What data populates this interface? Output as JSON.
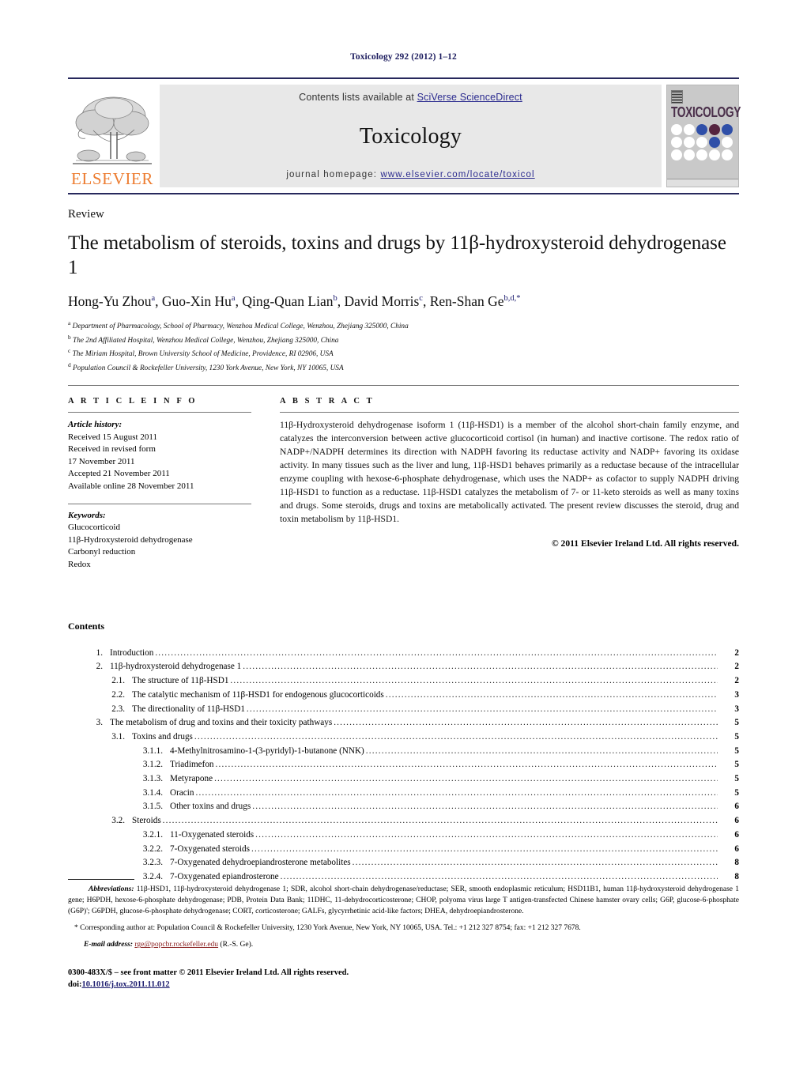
{
  "running_head": "Toxicology 292 (2012) 1–12",
  "masthead": {
    "publisher_name": "ELSEVIER",
    "contents_prefix": "Contents lists available at ",
    "contents_link": "SciVerse ScienceDirect",
    "journal_name": "Toxicology",
    "homepage_prefix": "journal homepage: ",
    "homepage_link": "www.elsevier.com/locate/toxicol",
    "cover_title": "TOXICOLOGY",
    "link_color": "#2b2b8f",
    "rule_color": "#27285c",
    "banner_bg": "#e8e8e8"
  },
  "article": {
    "doctype": "Review",
    "title": "The metabolism of steroids, toxins and drugs by 11β-hydroxysteroid dehydrogenase 1",
    "authors_html": "Hong-Yu Zhou a , Guo-Xin Hu a , Qing-Quan Lian b , David Morris c , Ren-Shan Ge b,d,*",
    "authors": [
      {
        "name": "Hong-Yu Zhou",
        "marks": "a"
      },
      {
        "name": "Guo-Xin Hu",
        "marks": "a"
      },
      {
        "name": "Qing-Quan Lian",
        "marks": "b"
      },
      {
        "name": "David Morris",
        "marks": "c"
      },
      {
        "name": "Ren-Shan Ge",
        "marks": "b,d,*"
      }
    ],
    "affiliations": [
      {
        "mark": "a",
        "text": "Department of Pharmacology, School of Pharmacy, Wenzhou Medical College, Wenzhou, Zhejiang 325000, China"
      },
      {
        "mark": "b",
        "text": "The 2nd Affiliated Hospital, Wenzhou Medical College, Wenzhou, Zhejiang 325000, China"
      },
      {
        "mark": "c",
        "text": "The Miriam Hospital, Brown University School of Medicine, Providence, RI 02906, USA"
      },
      {
        "mark": "d",
        "text": "Population Council & Rockefeller University, 1230 York Avenue, New York, NY 10065, USA"
      }
    ]
  },
  "article_info": {
    "heading": "A R T I C L E   I N F O",
    "history_label": "Article history:",
    "history": [
      "Received 15 August 2011",
      "Received in revised form",
      "17 November 2011",
      "Accepted 21 November 2011",
      "Available online 28 November 2011"
    ],
    "keywords_label": "Keywords:",
    "keywords": [
      "Glucocorticoid",
      "11β-Hydroxysteroid dehydrogenase",
      "Carbonyl reduction",
      "Redox"
    ]
  },
  "abstract": {
    "heading": "A B S T R A C T",
    "text": "11β-Hydroxysteroid dehydrogenase isoform 1 (11β-HSD1) is a member of the alcohol short-chain family enzyme, and catalyzes the interconversion between active glucocorticoid cortisol (in human) and inactive cortisone. The redox ratio of NADP+/NADPH determines its direction with NADPH favoring its reductase activity and NADP+ favoring its oxidase activity. In many tissues such as the liver and lung, 11β-HSD1 behaves primarily as a reductase because of the intracellular enzyme coupling with hexose-6-phosphate dehydrogenase, which uses the NADP+ as cofactor to supply NADPH driving 11β-HSD1 to function as a reductase. 11β-HSD1 catalyzes the metabolism of 7- or 11-keto steroids as well as many toxins and drugs. Some steroids, drugs and toxins are metabolically activated. The present review discusses the steroid, drug and toxin metabolism by 11β-HSD1.",
    "copyright": "© 2011 Elsevier Ireland Ltd. All rights reserved."
  },
  "contents": {
    "heading": "Contents",
    "entries": [
      {
        "level": 1,
        "num": "1.",
        "label": "Introduction",
        "page": "2"
      },
      {
        "level": 1,
        "num": "2.",
        "label": "11β-hydroxysteroid dehydrogenase 1",
        "page": "2"
      },
      {
        "level": 2,
        "num": "2.1.",
        "label": "The structure of 11β-HSD1",
        "page": "2"
      },
      {
        "level": 2,
        "num": "2.2.",
        "label": "The catalytic mechanism of 11β-HSD1 for endogenous glucocorticoids",
        "page": "3"
      },
      {
        "level": 2,
        "num": "2.3.",
        "label": "The directionality of 11β-HSD1",
        "page": "3"
      },
      {
        "level": 1,
        "num": "3.",
        "label": "The metabolism of drug and toxins and their toxicity pathways",
        "page": "5"
      },
      {
        "level": 2,
        "num": "3.1.",
        "label": "Toxins and drugs",
        "page": "5"
      },
      {
        "level": 3,
        "num": "3.1.1.",
        "label": "4-Methylnitrosamino-1-(3-pyridyl)-1-butanone (NNK)",
        "page": "5"
      },
      {
        "level": 3,
        "num": "3.1.2.",
        "label": "Triadimefon",
        "page": "5"
      },
      {
        "level": 3,
        "num": "3.1.3.",
        "label": "Metyrapone",
        "page": "5"
      },
      {
        "level": 3,
        "num": "3.1.4.",
        "label": "Oracin",
        "page": "5"
      },
      {
        "level": 3,
        "num": "3.1.5.",
        "label": "Other toxins and drugs",
        "page": "6"
      },
      {
        "level": 2,
        "num": "3.2.",
        "label": "Steroids",
        "page": "6"
      },
      {
        "level": 3,
        "num": "3.2.1.",
        "label": "11-Oxygenated steroids",
        "page": "6"
      },
      {
        "level": 3,
        "num": "3.2.2.",
        "label": "7-Oxygenated steroids",
        "page": "6"
      },
      {
        "level": 3,
        "num": "3.2.3.",
        "label": "7-Oxygenated dehydroepiandrosterone metabolites",
        "page": "8"
      },
      {
        "level": 3,
        "num": "3.2.4.",
        "label": "7-Oxygenated epiandrosterone",
        "page": "8"
      }
    ]
  },
  "footnotes": {
    "abbrev_label": "Abbreviations:",
    "abbrev_text": "11β-HSD1, 11β-hydroxysteroid dehydrogenase 1; SDR, alcohol short-chain dehydrogenase/reductase; SER, smooth endoplasmic reticulum; HSD11B1, human 11β-hydroxysteroid dehydrogenase 1 gene; H6PDH, hexose-6-phosphate dehydrogenase; PDB, Protein Data Bank; 11DHC, 11-dehydrocorticosterone; CHOP, polyoma virus large T antigen-transfected Chinese hamster ovary cells; G6P, glucose-6-phosphate (G6P)'; G6PDH, glucose-6-phosphate dehydrogenase; CORT, corticosterone; GALFs, glycyrrhetinic acid-like factors; DHEA, dehydroepiandrosterone.",
    "corresponding": "* Corresponding author at: Population Council & Rockefeller University, 1230 York Avenue, New York, NY 10065, USA. Tel.: +1 212 327 8754; fax: +1 212 327 7678.",
    "email_label": "E-mail address:",
    "email": "rge@popcbr.rockefeller.edu",
    "email_suffix": " (R.-S. Ge).",
    "issn_line": "0300-483X/$ – see front matter © 2011 Elsevier Ireland Ltd. All rights reserved.",
    "doi_label": "doi:",
    "doi": "10.1016/j.tox.2011.11.012"
  }
}
